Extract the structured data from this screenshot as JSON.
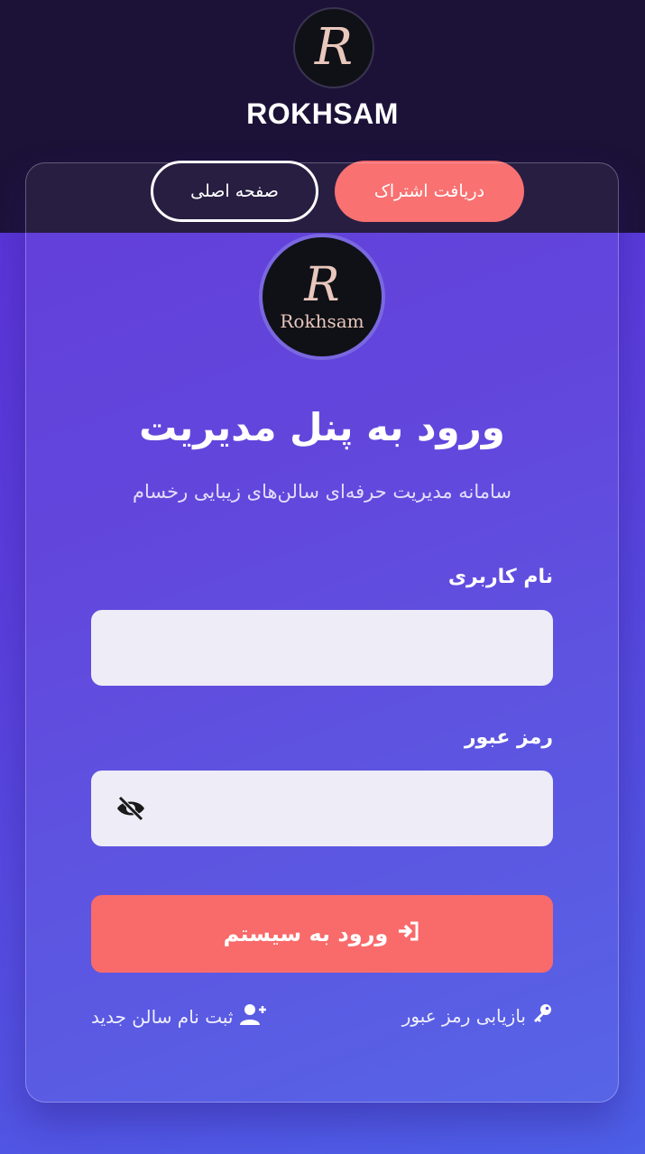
{
  "header": {
    "brand": "ROKHSAM",
    "logo_letter": "R",
    "subscribe_label": "دریافت اشتراک",
    "home_label": "صفحه اصلی"
  },
  "card": {
    "logo_letter": "R",
    "logo_text": "Rokhsam",
    "title": "ورود به پنل مدیریت",
    "subtitle": "سامانه مدیریت حرفه‌ای سالن‌های زیبایی رخسام"
  },
  "form": {
    "username_label": "نام کاربری",
    "username_value": "",
    "password_label": "رمز عبور",
    "password_value": "",
    "login_label": "ورود به سیستم"
  },
  "links": {
    "forgot_password": "بازیابی رمز عبور",
    "register": "ثبت نام سالن جدید"
  },
  "icons": {
    "password_toggle": "eye-slash-icon",
    "login": "sign-in-icon",
    "forgot": "key-icon",
    "register": "user-plus-icon"
  },
  "colors": {
    "accent": "#f96a6a",
    "header_bg": "#1c1238",
    "background_start": "#5b2fd6",
    "background_end": "#4d5fe6"
  }
}
